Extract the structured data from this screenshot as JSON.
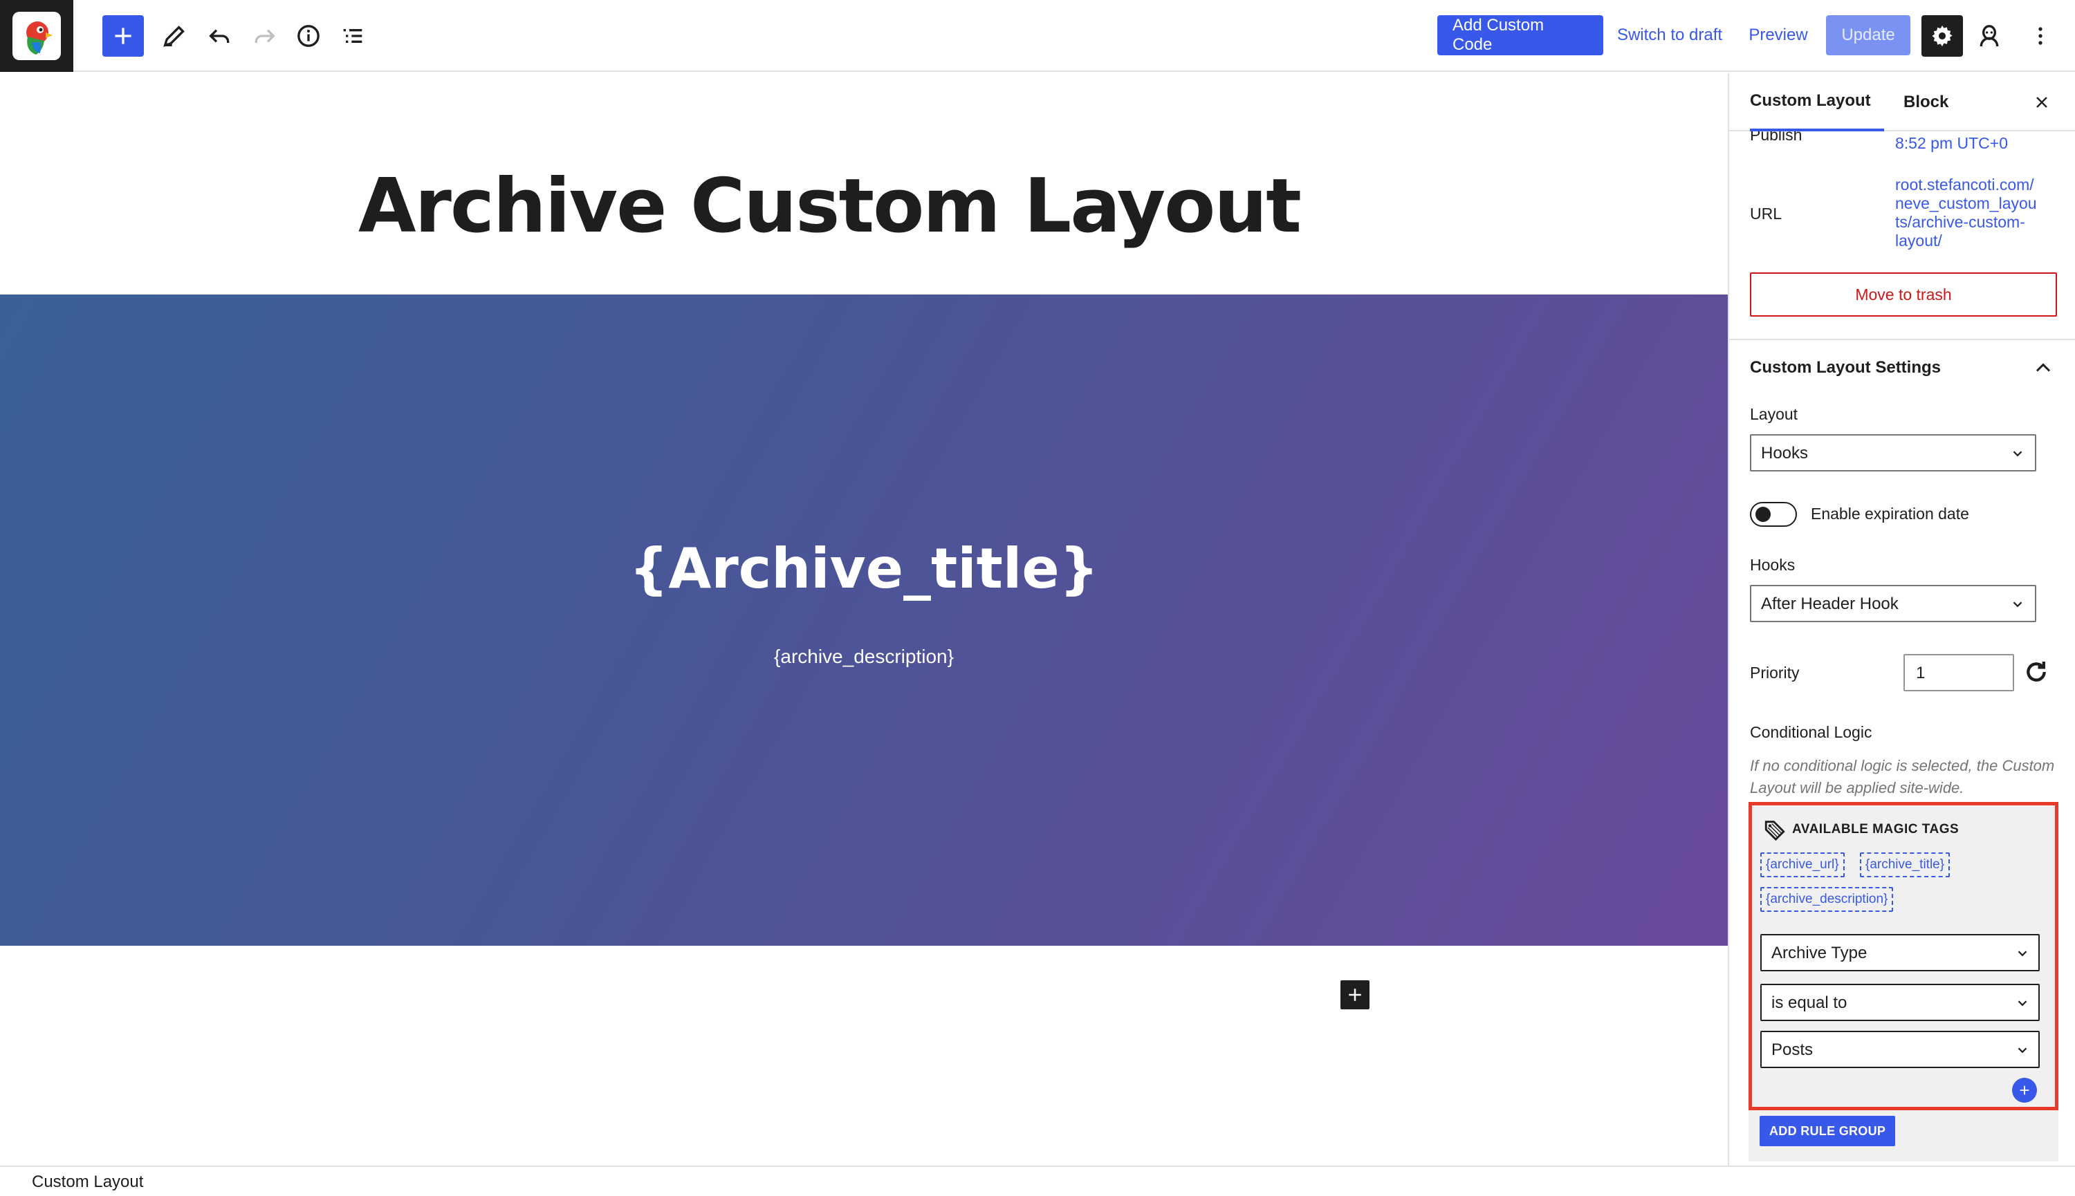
{
  "toolbar": {
    "add_custom_code_label": "Add Custom Code",
    "switch_to_draft_label": "Switch to draft",
    "preview_label": "Preview",
    "update_label": "Update",
    "icons": [
      "block-inserter-plus-icon",
      "tools-pencil-icon",
      "undo-icon",
      "redo-icon",
      "details-info-icon",
      "list-view-icon",
      "settings-gear-icon",
      "user-avatar-icon",
      "more-options-icon"
    ]
  },
  "canvas": {
    "post_title": "Archive Custom Layout",
    "cover_title": "{Archive_title}",
    "cover_description": "{archive_description}",
    "cover_gradient": [
      "#3a6196",
      "#6a4a9c"
    ]
  },
  "footer": {
    "breadcrumb": "Custom Layout"
  },
  "sidebar": {
    "tabs": [
      {
        "label": "Custom Layout",
        "active": true
      },
      {
        "label": "Block",
        "active": false
      }
    ],
    "publish_label": "Publish",
    "publish_value": "8:52 pm UTC+0",
    "url_label": "URL",
    "url_lines": [
      "root.stefancoti.com/",
      "neve_custom_layou",
      "ts/archive-custom-",
      "layout/"
    ],
    "move_to_trash_label": "Move to trash",
    "settings_panel": {
      "title": "Custom Layout Settings",
      "layout_label": "Layout",
      "layout_value": "Hooks",
      "expiration_label": "Enable expiration date",
      "expiration_enabled": false,
      "hooks_label": "Hooks",
      "hooks_value": "After Header Hook",
      "priority_label": "Priority",
      "priority_value": "1",
      "conditional_logic_label": "Conditional Logic",
      "conditional_logic_hint": "If no conditional logic is selected, the Custom Layout will be applied site-wide.",
      "magic_tags_heading": "AVAILABLE MAGIC TAGS",
      "magic_tags": [
        "{archive_url}",
        "{archive_title}",
        "{archive_description}"
      ],
      "rule": {
        "field": "Archive Type",
        "operator": "is equal to",
        "value": "Posts"
      },
      "add_rule_group_label": "ADD RULE GROUP"
    }
  },
  "colors": {
    "accent": "#3858e9",
    "danger": "#cc1818",
    "highlight_box": "#e83a2b"
  }
}
